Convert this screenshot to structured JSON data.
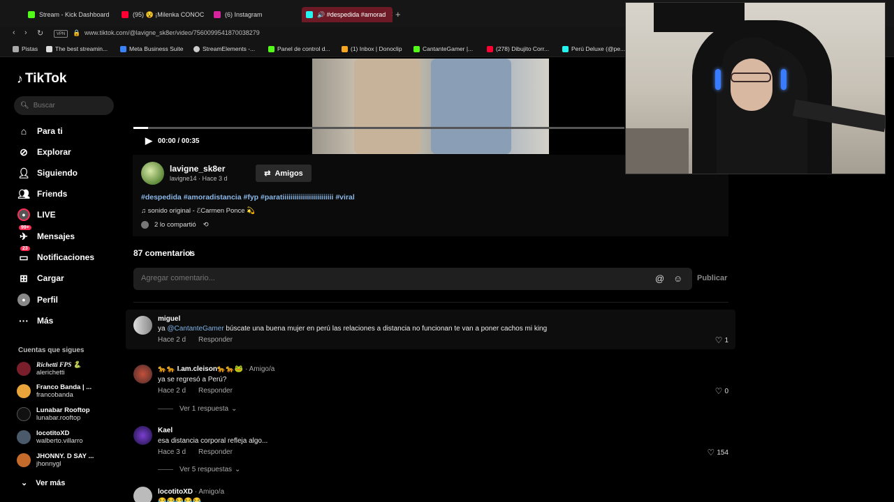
{
  "browser": {
    "tabs": [
      {
        "label": "Stream - Kick Dashboard",
        "color": "#53fc18"
      },
      {
        "label": "(95) 😵 ¡Milenka CONOC",
        "color": "#ff0033"
      },
      {
        "label": "(6) Instagram",
        "color": "#d6249f"
      },
      {
        "label": "🔊 #despedida #amorad",
        "color": "#25f4ee"
      }
    ],
    "new_tab": "+",
    "tab_close": "✕",
    "url": "www.tiktok.com/@lavigne_sk8er/video/7560099541870038279",
    "vpn": "VPN",
    "bookmarks": [
      "Pistas",
      "The best streamin...",
      "Meta Business Suite",
      "StreamElements -...",
      "Panel de control d...",
      "(1) Inbox | Donoclip",
      "CantanteGamer |...",
      "(278) Dibujito Corr...",
      "Perú Deluxe (@pe..."
    ]
  },
  "sidebar": {
    "logo": "TikTok",
    "search_placeholder": "Buscar",
    "nav": [
      {
        "label": "Para ti",
        "icon": "home-icon"
      },
      {
        "label": "Explorar",
        "icon": "compass-icon"
      },
      {
        "label": "Siguiendo",
        "icon": "following-icon"
      },
      {
        "label": "Friends",
        "icon": "friends-icon"
      },
      {
        "label": "LIVE",
        "icon": "live-icon"
      },
      {
        "label": "Mensajes",
        "icon": "messages-icon",
        "badge": "99+"
      },
      {
        "label": "Notificaciones",
        "icon": "notifications-icon",
        "badge": "23"
      },
      {
        "label": "Cargar",
        "icon": "upload-icon"
      },
      {
        "label": "Perfil",
        "icon": "profile-icon"
      },
      {
        "label": "Más",
        "icon": "more-icon"
      }
    ],
    "following_header": "Cuentas que sigues",
    "following": [
      {
        "name": "Richetti FPS 🐍",
        "user": "alerichetti"
      },
      {
        "name": "Franco Banda | ...",
        "user": "francobanda"
      },
      {
        "name": "Lunabar Rooftop",
        "user": "lunabar.rooftop"
      },
      {
        "name": "locotitoXD",
        "user": "walberto.villarro"
      },
      {
        "name": "JHONNY. D SAY ...",
        "user": "jhonnygl"
      }
    ],
    "see_more": "Ver más"
  },
  "video": {
    "time": "00:00 / 00:35",
    "progress": 0.03
  },
  "post": {
    "author": "lavigne_sk8er",
    "meta": "lavigne14 · Hace 3 d",
    "friends_label": "Amigos",
    "hashtags": "#despedida #amoradistancia #fyp #paratiiiiiiiiiiiiiiiiiiiiiiiii #viral",
    "music": "♫ sonido original - ℰCarmen Ponce 💫",
    "shared": "2 lo compartió"
  },
  "comments": {
    "count": "87 comentarios",
    "placeholder": "Agregar comentario...",
    "publish": "Publicar",
    "items": [
      {
        "user": "miguel",
        "tag": "",
        "mention": "@CantanteGamer",
        "text_before": "ya ",
        "text": " búscate una buena mujer en perú las relaciones a distancia no funcionan te van a poner cachos mi king",
        "time": "Hace 2 d",
        "reply": "Responder",
        "likes": "1",
        "replies": ""
      },
      {
        "user": "🐆🐆 I.am.cleison🐆🐆🐸",
        "tag": "· Amigo/a",
        "mention": "",
        "text_before": "",
        "text": "ya se regresó a Perú?",
        "time": "Hace 2 d",
        "reply": "Responder",
        "likes": "0",
        "replies": "Ver 1 respuesta"
      },
      {
        "user": "Kael",
        "tag": "",
        "mention": "",
        "text_before": "",
        "text": "esa distancia corporal refleja algo...",
        "time": "Hace 3 d",
        "reply": "Responder",
        "likes": "154",
        "replies": "Ver 5 respuestas"
      },
      {
        "user": "locotitoXD",
        "tag": "· Amigo/a",
        "mention": "",
        "text_before": "",
        "text": "😂😂😂😂😂",
        "time": "",
        "reply": "",
        "likes": "",
        "replies": ""
      }
    ]
  },
  "colors": {
    "accent": "#fe2c55",
    "link": "#8ab8e8"
  }
}
